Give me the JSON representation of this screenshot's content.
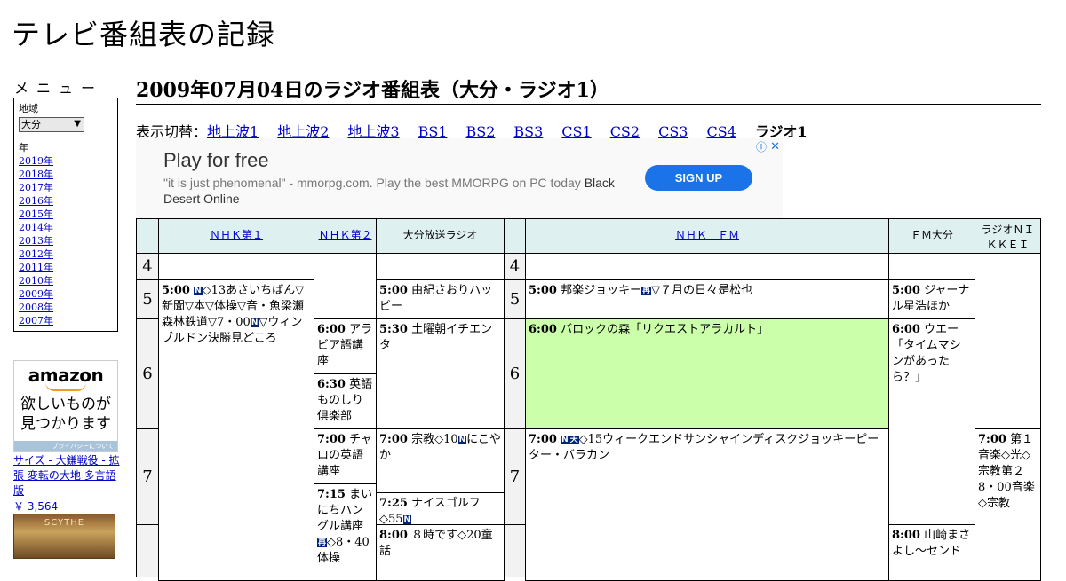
{
  "site_title": "テレビ番組表の記録",
  "menu": {
    "title": "メニュー",
    "region_label": "地域",
    "region_value": "大分",
    "year_label": "年",
    "years": [
      "2019年",
      "2018年",
      "2017年",
      "2016年",
      "2015年",
      "2014年",
      "2013年",
      "2012年",
      "2011年",
      "2010年",
      "2009年",
      "2008年",
      "2007年"
    ]
  },
  "amazon_ad": {
    "logo": "amazon",
    "text": "欲しいものが見つかります",
    "privacy": "プライバシーについて",
    "product_title": "サイズ - 大鎌戦役 - 拡張 変転の大地 多言語版",
    "product_price": "￥ 3,564",
    "product_image_text": "SCYTHE"
  },
  "page_title": "2009年07月04日のラジオ番組表（大分・ラジオ1）",
  "switcher": {
    "label": "表示切替：",
    "links": [
      "地上波1",
      "地上波2",
      "地上波3",
      "BS1",
      "BS2",
      "BS3",
      "CS1",
      "CS2",
      "CS3",
      "CS4"
    ],
    "current": "ラジオ1"
  },
  "banner_ad": {
    "headline": "Play for free",
    "body": "\"it is just phenomenal\" - mmorpg.com. Play the best MMORPG on PC today",
    "body_strong": "Black Desert Online",
    "cta": "SIGN UP",
    "info_icon": "ⓘ",
    "close_icon": "✕"
  },
  "channels": [
    "ＮＨＫ第１",
    "ＮＨＫ第２",
    "大分放送ラジオ",
    "ＮＨＫ　ＦＭ",
    "ＦＭ大分",
    "ラジオＮＩＫＫＥＩ"
  ],
  "hours": [
    "4",
    "5",
    "6",
    "7",
    "4",
    "5",
    "6",
    "7"
  ],
  "programs": {
    "nhk1_0500": {
      "time": "5:00",
      "badge": "N",
      "text": "◇13あさいちばん▽新聞▽本▽体操▽音・魚梁瀬森林鉄道▽7・00",
      "badge2": "N",
      "text2": "▽ウィンブルドン決勝見どころ"
    },
    "nhk2_0600": {
      "time": "6:00",
      "text": "アラビア語講座"
    },
    "nhk2_0630": {
      "time": "6:30",
      "text": "英語ものしり倶楽部"
    },
    "nhk2_0700": {
      "time": "7:00",
      "text": "チャロの英語講座"
    },
    "nhk2_0715": {
      "time": "7:15",
      "text": "まいにちハングル講座",
      "badge": "再",
      "text2": "◇8・40体操"
    },
    "obs_0500": {
      "time": "5:00",
      "text": "由紀さおりハッピー"
    },
    "obs_0530": {
      "time": "5:30",
      "text": "土曜朝イチエンタ"
    },
    "obs_0700": {
      "time": "7:00",
      "text": "宗教◇10",
      "badge": "N",
      "text2": "にこやか"
    },
    "obs_0725": {
      "time": "7:25",
      "text": "ナイスゴルフ◇55",
      "badge": "N"
    },
    "obs_0800": {
      "time": "8:00",
      "text": "８時です◇20童話"
    },
    "fm_0500": {
      "time": "5:00",
      "text": "邦楽ジョッキー",
      "badge": "再",
      "text2": "▽７月の日々是松也"
    },
    "fm_0600": {
      "time": "6:00",
      "text": "バロックの森「リクエストアラカルト」"
    },
    "fm_0700": {
      "time": "7:00",
      "badge": "N",
      "badge2": "天",
      "text": "◇15ウィークエンドサンシャインディスクジョッキーピーター・バラカン"
    },
    "fmoita_0500": {
      "time": "5:00",
      "text": "ジャーナル星浩ほか"
    },
    "fmoita_0600": {
      "time": "6:00",
      "text": "ウエー「タイムマシンがあったら？」"
    },
    "fmoita_0800": {
      "time": "8:00",
      "text": "山崎まさよし～センド"
    },
    "nikkei_0700": {
      "time": "7:00",
      "text": "第１音楽◇光◇宗教第２ 8・00音楽◇宗教"
    }
  }
}
